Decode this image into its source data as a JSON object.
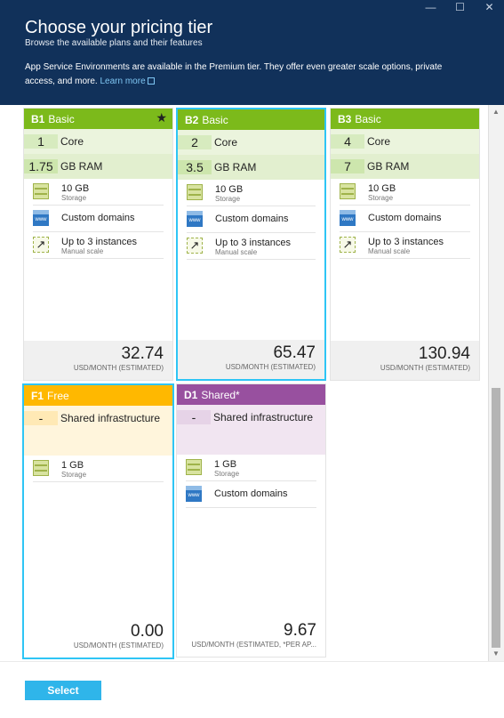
{
  "window": {
    "minimize": "—",
    "maximize": "☐",
    "close": "✕"
  },
  "header": {
    "title": "Choose your pricing tier",
    "subtitle": "Browse the available plans and their features",
    "info": "App Service Environments are available in the Premium tier. They offer even greater scale options, private access, and more.",
    "learn_more": "Learn more"
  },
  "cards": [
    {
      "code": "B1",
      "name": "Basic",
      "starred": true,
      "core_num": "1",
      "core_label": "Core",
      "ram_num": "1.75",
      "ram_label": "GB RAM",
      "features": [
        {
          "icon": "storage-icon",
          "title": "10 GB",
          "sub": "Storage"
        },
        {
          "icon": "www-icon",
          "title": "Custom domains",
          "sub": ""
        },
        {
          "icon": "scale-icon",
          "title": "Up to 3 instances",
          "sub": "Manual scale"
        }
      ],
      "price": "32.74",
      "unit": "USD/MONTH (ESTIMATED)"
    },
    {
      "code": "B2",
      "name": "Basic",
      "starred": false,
      "core_num": "2",
      "core_label": "Core",
      "ram_num": "3.5",
      "ram_label": "GB RAM",
      "features": [
        {
          "icon": "storage-icon",
          "title": "10 GB",
          "sub": "Storage"
        },
        {
          "icon": "www-icon",
          "title": "Custom domains",
          "sub": ""
        },
        {
          "icon": "scale-icon",
          "title": "Up to 3 instances",
          "sub": "Manual scale"
        }
      ],
      "price": "65.47",
      "unit": "USD/MONTH (ESTIMATED)"
    },
    {
      "code": "B3",
      "name": "Basic",
      "starred": false,
      "core_num": "4",
      "core_label": "Core",
      "ram_num": "7",
      "ram_label": "GB RAM",
      "features": [
        {
          "icon": "storage-icon",
          "title": "10 GB",
          "sub": "Storage"
        },
        {
          "icon": "www-icon",
          "title": "Custom domains",
          "sub": ""
        },
        {
          "icon": "scale-icon",
          "title": "Up to 3 instances",
          "sub": "Manual scale"
        }
      ],
      "price": "130.94",
      "unit": "USD/MONTH (ESTIMATED)"
    },
    {
      "code": "F1",
      "name": "Free",
      "starred": false,
      "core_num": "-",
      "core_label": "Shared infrastructure",
      "ram_num": "",
      "ram_label": "",
      "features": [
        {
          "icon": "storage-icon",
          "title": "1 GB",
          "sub": "Storage"
        }
      ],
      "price": "0.00",
      "unit": "USD/MONTH (ESTIMATED)"
    },
    {
      "code": "D1",
      "name": "Shared*",
      "starred": false,
      "core_num": "-",
      "core_label": "Shared infrastructure",
      "ram_num": "",
      "ram_label": "",
      "features": [
        {
          "icon": "storage-icon",
          "title": "1 GB",
          "sub": "Storage"
        },
        {
          "icon": "www-icon",
          "title": "Custom domains",
          "sub": ""
        }
      ],
      "price": "9.67",
      "unit": "USD/MONTH (ESTIMATED, *PER AP..."
    }
  ],
  "footer": {
    "select_label": "Select"
  },
  "colors": {
    "header_bg": "#11315a",
    "basic": "#7cba1b",
    "free": "#ffb800",
    "shared": "#98509f",
    "selected_border": "#2ec5f5",
    "select_button": "#2fb5ea"
  }
}
